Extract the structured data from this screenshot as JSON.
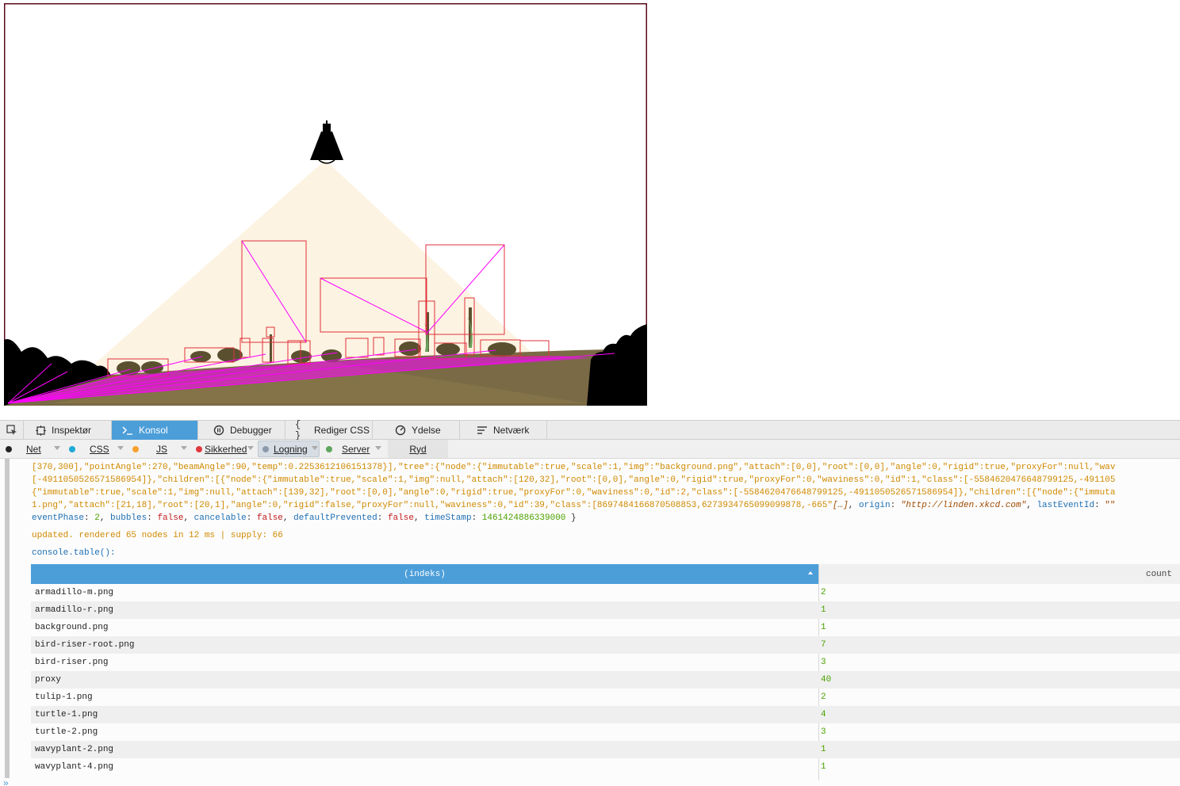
{
  "devtools": {
    "tabs": [
      {
        "label": "Inspektør",
        "icon": "inspector-icon"
      },
      {
        "label": "Konsol",
        "icon": "console-icon"
      },
      {
        "label": "Debugger",
        "icon": "debugger-icon"
      },
      {
        "label": "Rediger CSS",
        "icon": "style-editor-icon"
      },
      {
        "label": "Ydelse",
        "icon": "performance-icon"
      },
      {
        "label": "Netværk",
        "icon": "network-icon"
      }
    ],
    "filters": [
      {
        "label": "Net",
        "color": "#222222"
      },
      {
        "label": "CSS",
        "color": "#1fa9d6"
      },
      {
        "label": "JS",
        "color": "#f7a02b"
      },
      {
        "label": "Sikkerhed",
        "color": "#e0383e"
      },
      {
        "label": "Logning",
        "color": "#8a9aab"
      },
      {
        "label": "Server",
        "color": "#5ea55e"
      },
      {
        "label": "Ryd"
      }
    ],
    "active_tab_color": "#4c9ed9"
  },
  "console": {
    "event_lines": [
      "[370,300],\"pointAngle\":270,\"beamAngle\":90,\"temp\":0.2253612106151378}],\"tree\":{\"node\":{\"immutable\":true,\"scale\":1,\"img\":\"background.png\",\"attach\":[0,0],\"root\":[0,0],\"angle\":0,\"rigid\":true,\"proxyFor\":null,\"wav",
      "[-4911050526571586954]},\"children\":[{\"node\":{\"immutable\":true,\"scale\":1,\"img\":null,\"attach\":[120,32],\"root\":[0,0],\"angle\":0,\"rigid\":true,\"proxyFor\":0,\"waviness\":0,\"id\":1,\"class\":[-5584620476648799125,-491105",
      "{\"immutable\":true,\"scale\":1,\"img\":null,\"attach\":[139,32],\"root\":[0,0],\"angle\":0,\"rigid\":true,\"proxyFor\":0,\"waviness\":0,\"id\":2,\"class\":[-5584620476648799125,-4911050526571586954]},\"children\":[{\"node\":{\"immuta",
      "1.png\",\"attach\":[21,18],\"root\":[20,1],\"angle\":0,\"rigid\":false,\"proxyFor\":null,\"waviness\":0,\"id\":39,\"class\":[8697484166870508853,6273934765099099878,-665\""
    ],
    "event_ellipsis": "[…]",
    "origin_key": "origin",
    "origin_value": "\"http://linden.xkcd.com\"",
    "last_event_key": "lastEventId",
    "last_event_value": "\"\"",
    "event_phase_key": "eventPhase",
    "event_phase_value": "2",
    "bubbles_key": "bubbles",
    "bubbles_value": "false",
    "cancelable_key": "cancelable",
    "cancelable_value": "false",
    "default_prevented_key": "defaultPrevented",
    "default_prevented_value": "false",
    "timestamp_key": "timeStamp",
    "timestamp_value": "1461424886339000",
    "updated_line": "updated. rendered 65 nodes in 12 ms | supply: 66",
    "table_call": "console.table():",
    "table": {
      "index_header": "(indeks)",
      "count_header": "count",
      "rows": [
        {
          "name": "armadillo-m.png",
          "count": "2"
        },
        {
          "name": "armadillo-r.png",
          "count": "1"
        },
        {
          "name": "background.png",
          "count": "1"
        },
        {
          "name": "bird-riser-root.png",
          "count": "7"
        },
        {
          "name": "bird-riser.png",
          "count": "3"
        },
        {
          "name": "proxy",
          "count": "40"
        },
        {
          "name": "tulip-1.png",
          "count": "2"
        },
        {
          "name": "turtle-1.png",
          "count": "4"
        },
        {
          "name": "turtle-2.png",
          "count": "3"
        },
        {
          "name": "wavyplant-2.png",
          "count": "1"
        },
        {
          "name": "wavyplant-4.png",
          "count": "1"
        }
      ]
    },
    "prompt_symbol": "»"
  },
  "scene": {
    "border_color": "#5a0a1a",
    "light_color": "#fdf3e2",
    "ground_color": "#7a6a45",
    "debug_box_color": "#e0303a",
    "debug_line_color": "#ff00ff"
  }
}
